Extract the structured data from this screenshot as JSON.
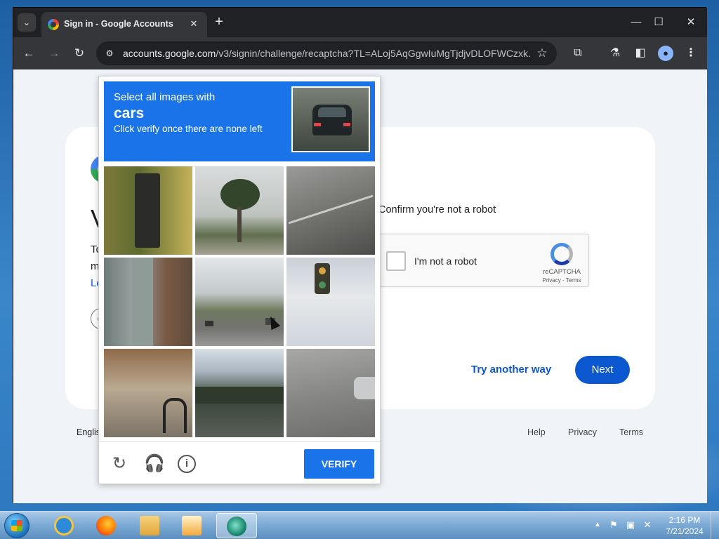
{
  "browser": {
    "tab": {
      "title": "Sign in - Google Accounts",
      "close_glyph": "✕"
    },
    "new_tab_glyph": "+",
    "window_controls": {
      "minimize": "—",
      "maximize": "☐",
      "close": "✕"
    },
    "toolbar": {
      "back": "←",
      "forward": "→",
      "reload": "↻",
      "site_info": "⚙",
      "url_host": "accounts.google.com",
      "url_path": "/v3/signin/challenge/recaptcha?TL=ALoj5AqGgwIuMgTjdjvDLOFWCzxk...",
      "star": "☆",
      "extensions": "⧉",
      "labs": "⚗",
      "side_panel": "◧",
      "profile": "●",
      "menu": "⋮"
    }
  },
  "login": {
    "heading_fragment": "V",
    "line_fragments": [
      "To",
      "m",
      "Le"
    ],
    "circle_fragment": "G",
    "robot_prompt": "Confirm you're not a robot",
    "checkbox_label": "I'm not a robot",
    "recaptcha_brand": "reCAPTCHA",
    "recaptcha_terms": "Privacy - Terms",
    "try_another": "Try another way",
    "next": "Next",
    "footer": {
      "language": "Englis",
      "help": "Help",
      "privacy": "Privacy",
      "terms": "Terms"
    }
  },
  "challenge": {
    "line1": "Select all images with",
    "target": "cars",
    "line3": "Click verify once there are none left",
    "verify": "VERIFY",
    "icons": {
      "reload": "↻",
      "audio": "🎧",
      "info": "i"
    }
  },
  "taskbar": {
    "time": "2:16 PM",
    "date": "7/21/2024",
    "tray": {
      "arrow": "▲",
      "flag": "⚑",
      "network": "▣",
      "volume": "✕"
    }
  },
  "colors": {
    "google_blue": "#0b57d0",
    "recaptcha_blue": "#1a73e8",
    "chrome_dark": "#202124",
    "page_bg": "#f0f4f9"
  }
}
